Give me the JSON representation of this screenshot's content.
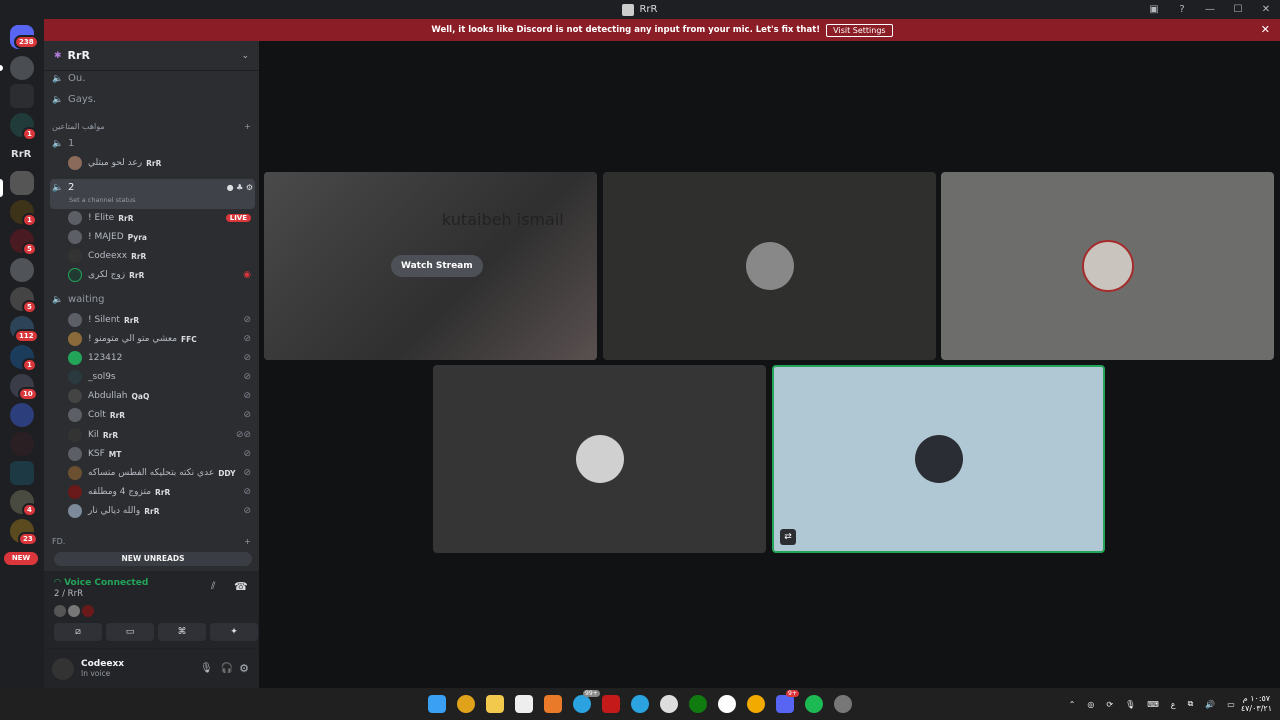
{
  "window": {
    "title": "RrR"
  },
  "banner": {
    "message": "Well, it looks like Discord is not detecting any input from your mic. Let's fix that!",
    "button": "Visit Settings"
  },
  "guilds": {
    "home_badge": "238",
    "badges": [
      "1",
      "1",
      "5",
      "5",
      "112",
      "1",
      "10",
      "4",
      "23"
    ],
    "rrr_label": "RrR",
    "new_label": "NEW"
  },
  "server": {
    "name": "RrR"
  },
  "channels": {
    "ou": "Ou.",
    "gays": "Gays.",
    "category_arabic": "مواهب المتاعين",
    "ch1": "1",
    "ch1_user": {
      "name": "رعد لحو مبتلي",
      "tag": "RrR"
    },
    "ch2": "2",
    "ch2_status": "Set a channel status",
    "ch2_users": [
      {
        "name": "! Elite",
        "tag": "RrR",
        "live": "LIVE"
      },
      {
        "name": "! MAJED",
        "tag": "Pyra"
      },
      {
        "name": "Codeexx",
        "tag": "RrR"
      },
      {
        "name": "زوج لكرى",
        "tag": "RrR"
      }
    ],
    "waiting": "waiting",
    "waiting_users": [
      {
        "name": "! Silent",
        "tag": "RrR"
      },
      {
        "name": "! معشي متو الي متومنو",
        "tag": "FFC"
      },
      {
        "name": "123412",
        "tag": ""
      },
      {
        "name": "_sol9s",
        "tag": ""
      },
      {
        "name": "Abdullah",
        "tag": "QaQ"
      },
      {
        "name": "Colt",
        "tag": "RrR"
      },
      {
        "name": "Kil",
        "tag": "RrR"
      },
      {
        "name": "KSF",
        "tag": "MT"
      },
      {
        "name": "عدي نكته بتحليكه الفطس متساكه",
        "tag": "DDY"
      },
      {
        "name": "متزوج 4 ومطلقه",
        "tag": "RrR"
      },
      {
        "name": "والله ديالي نار",
        "tag": "RrR"
      }
    ],
    "fd": "FD."
  },
  "unreads": "NEW UNREADS",
  "voice": {
    "status": "Voice Connected",
    "channel": "2 / RrR"
  },
  "userpanel": {
    "name": "Codeexx",
    "status": "In voice"
  },
  "stage": {
    "stream_name": "kutaibeh ismail",
    "watch": "Watch Stream"
  },
  "taskbar": {
    "time": "١٠:٥٧ م",
    "date": "٤٧/٠٣/٢١",
    "lang": "ع",
    "telegram_badge": "99+",
    "discord_badge": "9+"
  },
  "colors": {
    "accent": "#23a559",
    "danger": "#da373c",
    "banner": "#8b1d26"
  }
}
